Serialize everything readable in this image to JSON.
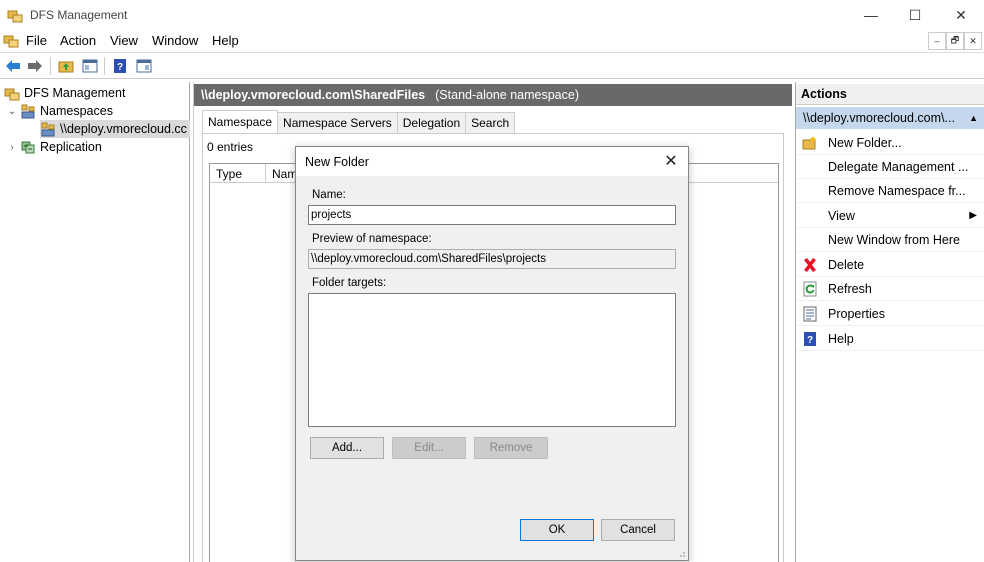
{
  "window": {
    "title": "DFS Management",
    "minimize_glyph": "—",
    "maximize_glyph": "☐",
    "close_glyph": "✕"
  },
  "menu": [
    "File",
    "Action",
    "View",
    "Window",
    "Help"
  ],
  "mdi_buttons": [
    "–",
    "🗗",
    "✕"
  ],
  "tree": {
    "root": "DFS Management",
    "namespaces": "Namespaces",
    "namespace_item": "\\\\deploy.vmorecloud.cc",
    "replication": "Replication"
  },
  "center": {
    "header_path": "\\\\deploy.vmorecloud.com\\SharedFiles",
    "header_sub": "(Stand-alone namespace)",
    "tabs": [
      "Namespace",
      "Namespace Servers",
      "Delegation",
      "Search"
    ],
    "entries": "0 entries",
    "columns": [
      "Type",
      "Nam"
    ]
  },
  "actions": {
    "title": "Actions",
    "group": "\\\\deploy.vmorecloud.com\\...",
    "items": [
      {
        "label": "New Folder...",
        "icon": "new-folder-icon"
      },
      {
        "label": "Delegate Management ...",
        "icon": ""
      },
      {
        "label": "Remove Namespace fr...",
        "icon": ""
      },
      {
        "label": "View",
        "icon": "",
        "submenu": true
      },
      {
        "label": "New Window from Here",
        "icon": ""
      },
      {
        "label": "Delete",
        "icon": "delete-icon"
      },
      {
        "label": "Refresh",
        "icon": "refresh-icon"
      },
      {
        "label": "Properties",
        "icon": "properties-icon"
      },
      {
        "label": "Help",
        "icon": "help-icon"
      }
    ]
  },
  "dialog": {
    "title": "New Folder",
    "name_label": "Name:",
    "name_value": "projects",
    "preview_label": "Preview of namespace:",
    "preview_value": "\\\\deploy.vmorecloud.com\\SharedFiles\\projects",
    "targets_label": "Folder targets:",
    "add_button": "Add...",
    "edit_button": "Edit...",
    "remove_button": "Remove",
    "ok_button": "OK",
    "cancel_button": "Cancel"
  },
  "colors": {
    "header_bg": "#696969",
    "action_group_bg": "#c4d7ec",
    "delete_red": "#e81123",
    "help_blue": "#2b4fb3",
    "folder_yellow": "#e8b84a"
  }
}
